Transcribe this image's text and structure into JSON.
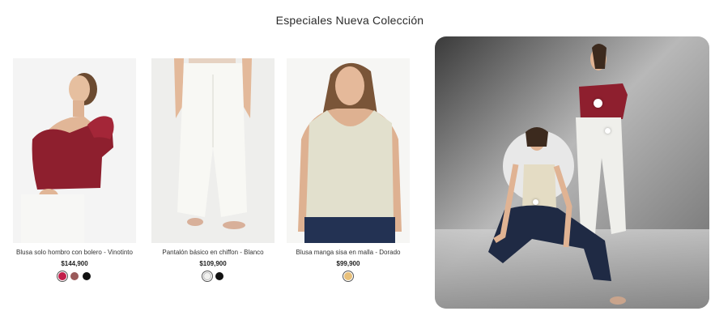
{
  "section": {
    "title": "Especiales Nueva Colección"
  },
  "products": [
    {
      "name": "Blusa solo hombro con bolero - Vinotinto",
      "price": "$144,900",
      "swatches": [
        "#c21f4a",
        "#9a5a5a",
        "#111111"
      ],
      "selected_swatch": 0
    },
    {
      "name": "Pantalón básico en chiffon - Blanco",
      "price": "$109,900",
      "swatches": [
        "#f1f1ef",
        "#111111"
      ],
      "selected_swatch": 0
    },
    {
      "name": "Blusa manga sisa en malla - Dorado",
      "price": "$99,900",
      "swatches": [
        "#e8c07a"
      ],
      "selected_swatch": 0
    }
  ],
  "colors": {
    "wine": "#8e1f2e",
    "cream": "#ebe8d9",
    "denim": "#1f2a44",
    "hero_bg": "#9a9a9a"
  }
}
